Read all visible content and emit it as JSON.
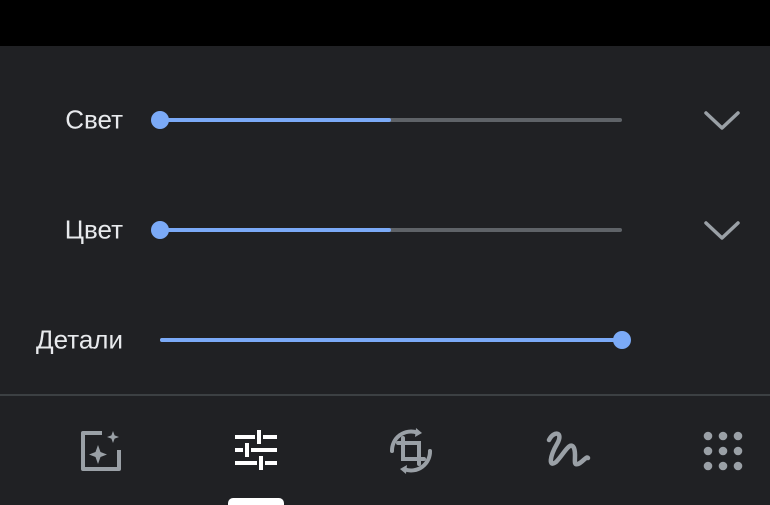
{
  "adjustments": {
    "light": {
      "label": "Свет",
      "value": 0.5
    },
    "color": {
      "label": "Цвет",
      "value": 0.5
    },
    "details": {
      "label": "Детали",
      "value": 1.0
    }
  },
  "toolbar": {
    "items": [
      {
        "icon": "auto-enhance-icon",
        "selected": false
      },
      {
        "icon": "adjust-sliders-icon",
        "selected": true
      },
      {
        "icon": "crop-rotate-icon",
        "selected": false
      },
      {
        "icon": "markup-icon",
        "selected": false
      },
      {
        "icon": "more-tools-icon",
        "selected": false
      }
    ]
  },
  "colors": {
    "background": "#202124",
    "accent": "#7baaf7",
    "track": "#5f6368",
    "text": "#e8eaed",
    "icon": "#9aa0a6"
  }
}
